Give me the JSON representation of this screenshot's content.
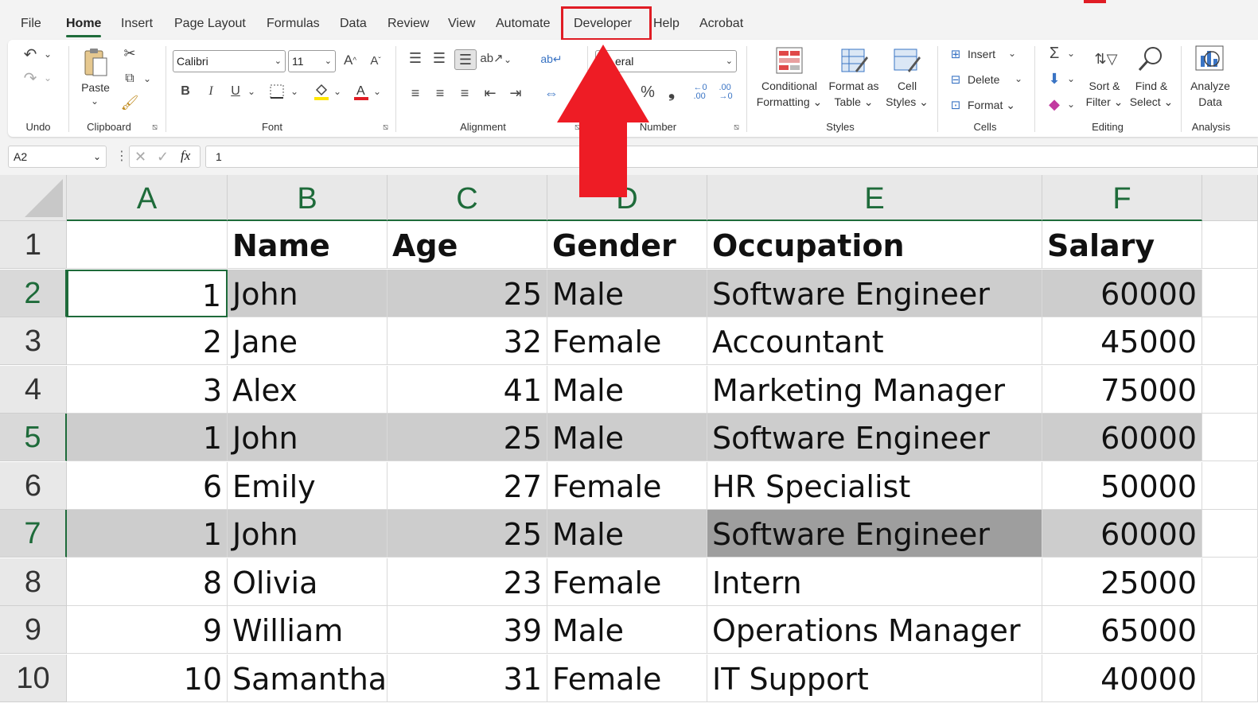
{
  "menu": {
    "tabs": [
      "File",
      "Home",
      "Insert",
      "Page Layout",
      "Formulas",
      "Data",
      "Review",
      "View",
      "Automate",
      "Developer",
      "Help",
      "Acrobat"
    ],
    "active": "Home",
    "highlighted": "Developer"
  },
  "ribbon": {
    "undo": {
      "label": "Undo"
    },
    "clipboard": {
      "label": "Clipboard",
      "paste": "Paste"
    },
    "font": {
      "label": "Font",
      "family": "Calibri",
      "size": "11",
      "bold": "B",
      "italic": "I",
      "underline": "U"
    },
    "alignment": {
      "label": "Alignment"
    },
    "number": {
      "label": "Number",
      "format": "General",
      "format_visible": "eral"
    },
    "styles": {
      "label": "Styles",
      "conditional_1": "Conditional",
      "conditional_2": "Formatting",
      "format_table_1": "Format as",
      "format_table_2": "Table",
      "cell_styles_1": "Cell",
      "cell_styles_2": "Styles"
    },
    "cells": {
      "label": "Cells",
      "insert": "Insert",
      "delete": "Delete",
      "format": "Format"
    },
    "editing": {
      "label": "Editing",
      "sort_1": "Sort &",
      "sort_2": "Filter",
      "find_1": "Find &",
      "find_2": "Select"
    },
    "analysis": {
      "label": "Analysis",
      "analyze_1": "Analyze",
      "analyze_2": "Data"
    }
  },
  "formula_bar": {
    "name_box": "A2",
    "fx": "fx",
    "value": "1"
  },
  "columns": [
    "A",
    "B",
    "C",
    "D",
    "E",
    "F"
  ],
  "rows": [
    {
      "n": "1",
      "cells": [
        "",
        "Name",
        "Age",
        "Gender",
        "Occupation",
        "Salary"
      ]
    },
    {
      "n": "2",
      "cells": [
        "1",
        "John",
        "25",
        "Male",
        "Software Engineer",
        "60000"
      ]
    },
    {
      "n": "3",
      "cells": [
        "2",
        "Jane",
        "32",
        "Female",
        "Accountant",
        "45000"
      ]
    },
    {
      "n": "4",
      "cells": [
        "3",
        "Alex",
        "41",
        "Male",
        "Marketing Manager",
        "75000"
      ]
    },
    {
      "n": "5",
      "cells": [
        "1",
        "John",
        "25",
        "Male",
        "Software Engineer",
        "60000"
      ]
    },
    {
      "n": "6",
      "cells": [
        "6",
        "Emily",
        "27",
        "Female",
        "HR Specialist",
        "50000"
      ]
    },
    {
      "n": "7",
      "cells": [
        "1",
        "John",
        "25",
        "Male",
        "Software Engineer",
        "60000"
      ]
    },
    {
      "n": "8",
      "cells": [
        "8",
        "Olivia",
        "23",
        "Female",
        "Intern",
        "25000"
      ]
    },
    {
      "n": "9",
      "cells": [
        "9",
        "William",
        "39",
        "Male",
        "Operations Manager",
        "65000"
      ]
    },
    {
      "n": "10",
      "cells": [
        "10",
        "Samantha",
        "31",
        "Female",
        "IT Support",
        "40000"
      ]
    }
  ],
  "highlighted_rows": [
    "2",
    "5",
    "7"
  ],
  "active_cell": "A2",
  "colors": {
    "accent": "#1e6b3a",
    "annotation": "#e01c24",
    "highlight": "#cdcdcd",
    "highlight_dark": "#9e9e9e"
  }
}
